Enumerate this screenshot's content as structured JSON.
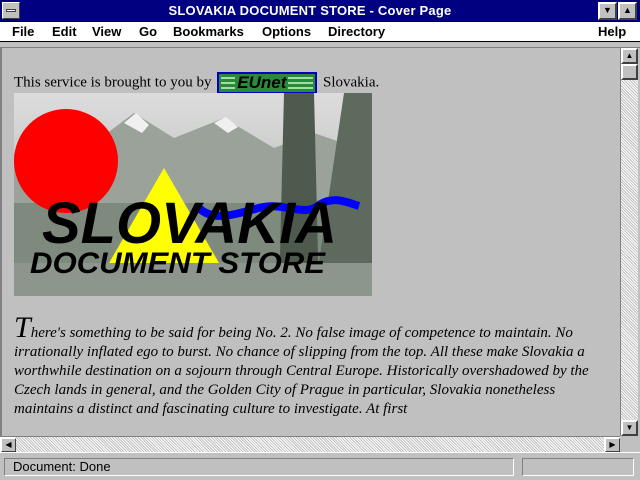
{
  "window": {
    "title": "SLOVAKIA DOCUMENT STORE - Cover Page"
  },
  "menu": {
    "items": [
      {
        "label": "File"
      },
      {
        "label": "Edit"
      },
      {
        "label": "View"
      },
      {
        "label": "Go"
      },
      {
        "label": "Bookmarks"
      },
      {
        "label": "Options"
      },
      {
        "label": "Directory"
      },
      {
        "label": "Help"
      }
    ]
  },
  "content": {
    "intro_before": "This service is brought to you by",
    "intro_after": "Slovakia.",
    "eunet_logo_text": "EUnet",
    "logo_line1": "SLOVAKIA",
    "logo_line2": "DOCUMENT STORE",
    "dropcap": "T",
    "paragraph": "here's something to be said for being No. 2. No false image of competence to maintain. No irrationally inflated ego to burst. No chance of slipping from the top. All these make Slovakia a worthwhile destination on a sojourn through Central Europe. Historically overshadowed by the Czech lands in general, and the Golden City of Prague in particular, Slovakia nonetheless maintains a distinct and fascinating culture to investigate. At first"
  },
  "status": {
    "text": "Document: Done"
  },
  "colors": {
    "titlebar": "#000080",
    "chrome": "#c0c0c0",
    "sun": "#ff0000",
    "triangle": "#ffff00",
    "river": "#0000ff"
  }
}
